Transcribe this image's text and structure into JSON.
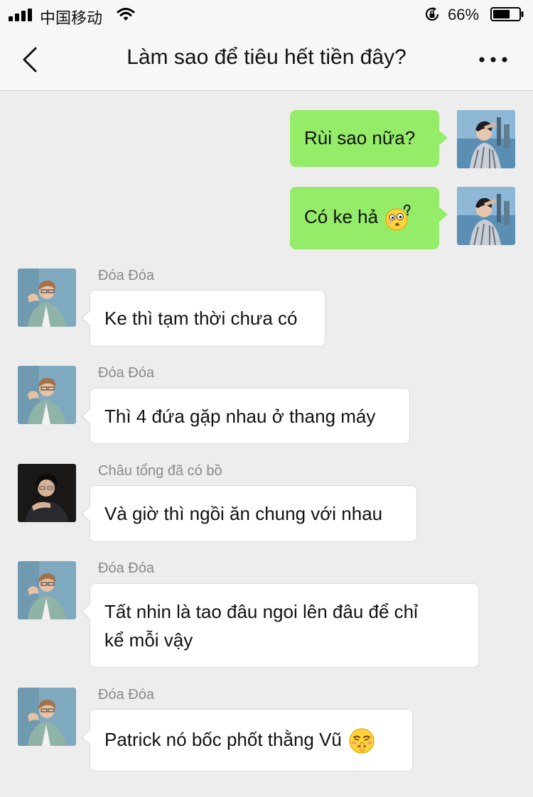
{
  "status_bar": {
    "carrier": "中国移动",
    "battery_percent": "66%",
    "battery_level": 0.66,
    "icons": [
      "signal-icon",
      "wifi-icon",
      "rotation-lock-icon",
      "battery-icon"
    ]
  },
  "nav": {
    "title": "Làm sao để tiêu hết tiền đây?",
    "icons": [
      "back-chevron-icon",
      "more-icon"
    ]
  },
  "messages": [
    {
      "from": "me",
      "text": "Rùi sao nữa?"
    },
    {
      "from": "me",
      "text": "Có ke hả",
      "emoji": "confused-face-emoji"
    },
    {
      "from": "other",
      "sender": "Đóa Đóa",
      "text": "Ke thì tạm thời chưa có"
    },
    {
      "from": "other",
      "sender": "Đóa Đóa",
      "text": "Thì 4 đứa gặp nhau ở thang máy"
    },
    {
      "from": "other",
      "sender": "Châu tổng đã có bồ",
      "text": "Và giờ thì ngồi ăn chung với nhau"
    },
    {
      "from": "other",
      "sender": "Đóa Đóa",
      "text_lines": [
        "Tất nhin là tao đâu ngoi lên đâu để chỉ",
        "kể mỗi vậy"
      ]
    },
    {
      "from": "other",
      "sender": "Đóa Đóa",
      "text": "Patrick nó bốc phốt thằng Vũ",
      "emoji": "shushing-face-emoji"
    }
  ],
  "colors": {
    "background": "#ededed",
    "my_bubble": "#95ec69",
    "other_bubble": "#ffffff",
    "sender_name": "#8a8a8a"
  }
}
